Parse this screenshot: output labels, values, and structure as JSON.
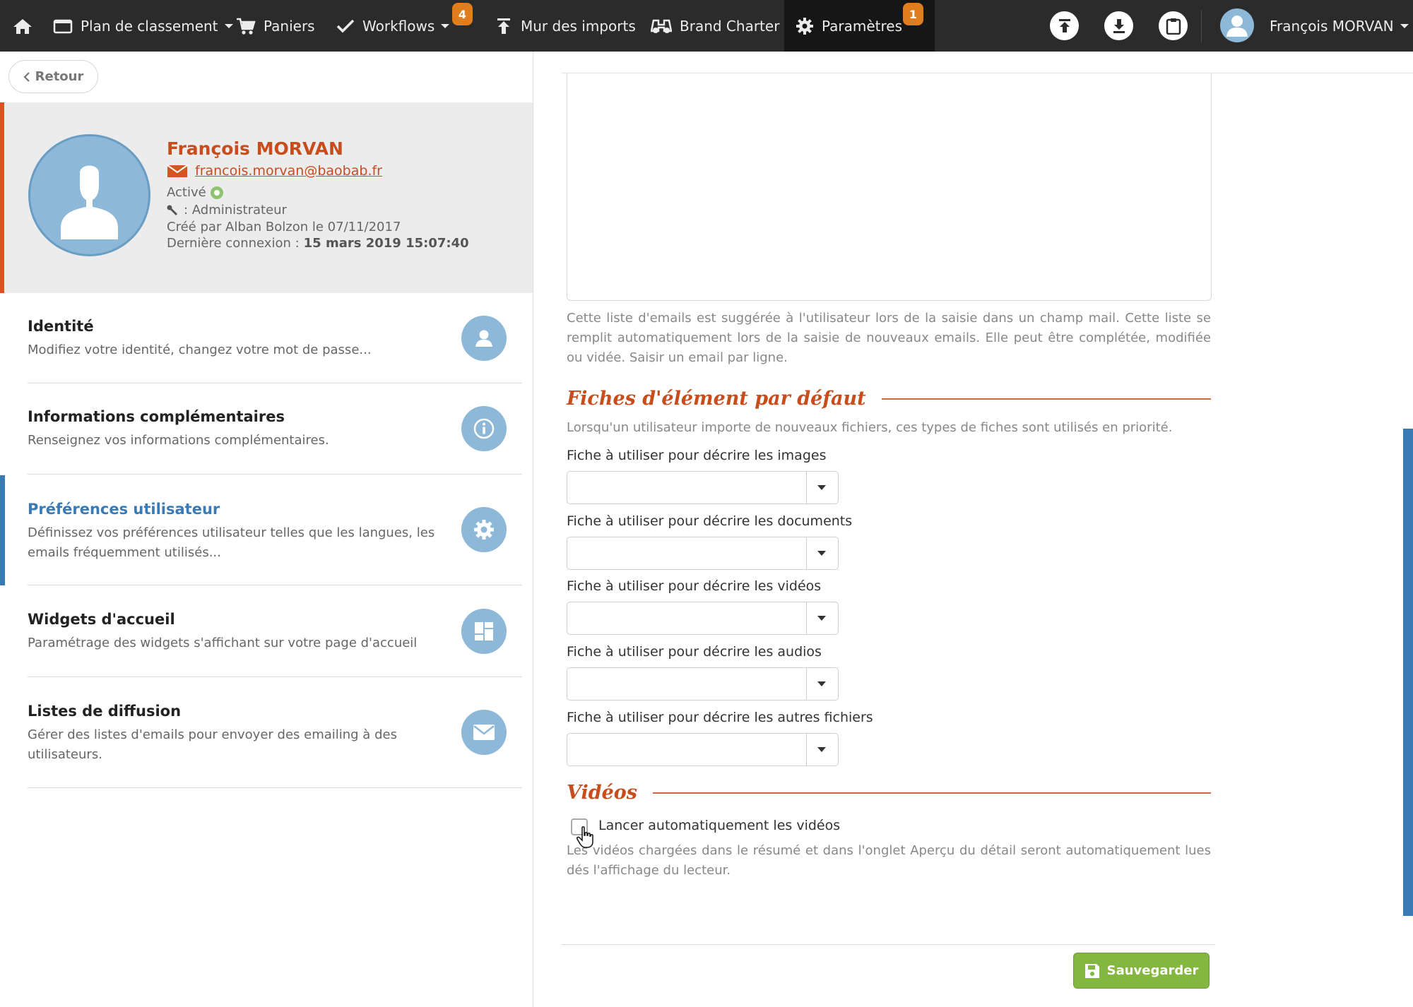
{
  "colors": {
    "topbar_bg": "#2b2b2b",
    "accent_orange": "#c84d1c",
    "badge_orange": "#e07d1f",
    "accent_blue": "#3a7ab5",
    "avatar_blue": "#8db8d8",
    "save_green": "#83b73f"
  },
  "topbar": {
    "home_icon": "home-icon",
    "items": [
      {
        "label": "Plan de classement",
        "icon": "folder-icon",
        "dropdown": true
      },
      {
        "label": "Paniers",
        "icon": "cart-icon"
      },
      {
        "label": "Workflows",
        "icon": "check-icon",
        "dropdown": true,
        "badge": "4"
      },
      {
        "label": "Mur des imports",
        "icon": "import-icon"
      },
      {
        "label": "Brand Charter",
        "icon": "binoculars-icon"
      },
      {
        "label": "Paramètres",
        "icon": "gear-icon",
        "badge": "1",
        "active": true
      }
    ],
    "actions": [
      "upload-icon",
      "download-icon",
      "clipboard-icon"
    ],
    "user_name": "François MORVAN"
  },
  "sidebar": {
    "back_label": "Retour",
    "profile": {
      "name": "François MORVAN",
      "email": "francois.morvan@baobab.fr",
      "status": "Activé",
      "role": ": Administrateur",
      "created": "Créé par Alban Bolzon le 07/11/2017",
      "last_login_label": "Dernière connexion :",
      "last_login_value": "15 mars 2019 15:07:40"
    },
    "menu": [
      {
        "title": "Identité",
        "desc": "Modifiez votre identité, changez votre mot de passe...",
        "icon": "user-icon"
      },
      {
        "title": "Informations complémentaires",
        "desc": "Renseignez vos informations complémentaires.",
        "icon": "info-icon"
      },
      {
        "title": "Préférences utilisateur",
        "desc": "Définissez vos préférences utilisateur telles que les langues, les emails fréquemment utilisés...",
        "icon": "gear-icon",
        "active": true
      },
      {
        "title": "Widgets d'accueil",
        "desc": "Paramétrage des widgets s'affichant sur votre page d'accueil",
        "icon": "dashboard-icon"
      },
      {
        "title": "Listes de diffusion",
        "desc": "Gérer des listes d'emails pour envoyer des emailing à des utilisateurs.",
        "icon": "envelope-icon"
      }
    ]
  },
  "main": {
    "emails_help": "Cette liste d'emails est suggérée à l'utilisateur lors de la saisie dans un champ mail. Cette liste se remplit automatiquement lors de la saisie de nouveaux emails. Elle peut être complétée, modifiée ou vidée. Saisir un email par ligne.",
    "fiches": {
      "title": "Fiches d'élément par défaut",
      "help": "Lorsqu'un utilisateur importe de nouveaux fichiers, ces types de fiches sont utilisés en priorité.",
      "fields": [
        {
          "label": "Fiche à utiliser pour décrire les images",
          "value": ""
        },
        {
          "label": "Fiche à utiliser pour décrire les documents",
          "value": ""
        },
        {
          "label": "Fiche à utiliser pour décrire les vidéos",
          "value": ""
        },
        {
          "label": "Fiche à utiliser pour décrire les audios",
          "value": ""
        },
        {
          "label": "Fiche à utiliser pour décrire les autres fichiers",
          "value": ""
        }
      ]
    },
    "videos": {
      "title": "Vidéos",
      "autoplay_label": "Lancer automatiquement les vidéos",
      "autoplay_checked": false,
      "help": "Les vidéos chargées dans le résumé et dans l'onglet Aperçu du détail seront automatiquement lues dés l'affichage du lecteur."
    },
    "save_label": "Sauvegarder"
  }
}
